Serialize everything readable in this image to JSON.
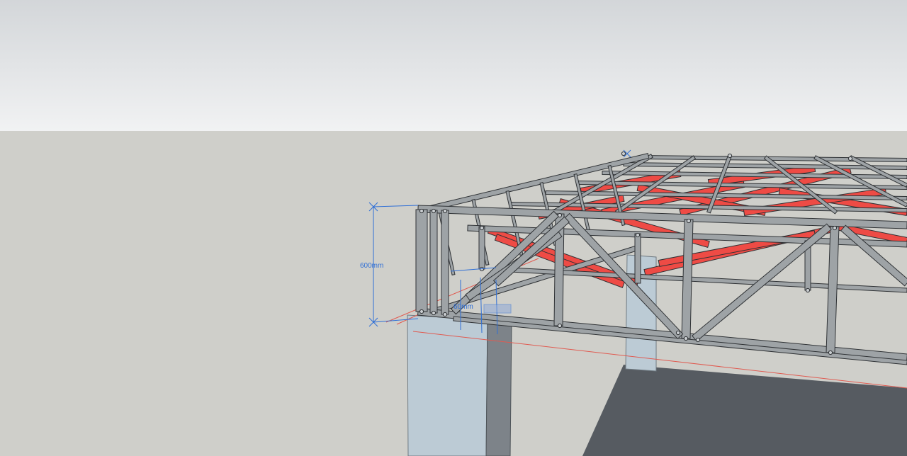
{
  "colors": {
    "sky_top": "#d3d6d9",
    "sky_bottom": "#f1f2f3",
    "ground": "#cfcfca",
    "column_front": "#bccbd5",
    "column_side": "#7d8389",
    "floor_slab": "#565b61",
    "steel": "#9ea3a6",
    "steel_edge": "#2f3235",
    "bracing_red": "#ee4b45",
    "dimension_blue": "#2f6fd6",
    "guide_red": "#e05a50"
  },
  "dimensions": {
    "vertical_label": "600mm",
    "small_label": "60mm"
  }
}
